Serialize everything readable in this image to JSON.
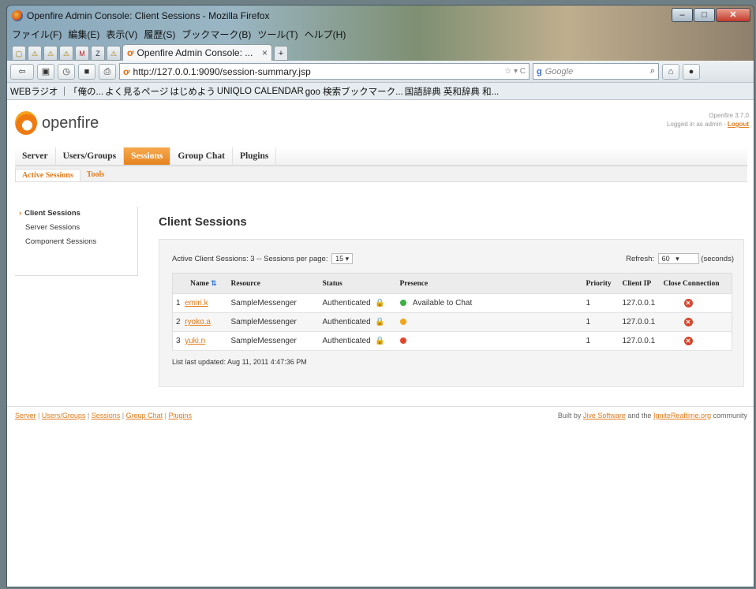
{
  "window": {
    "title": "Openfire Admin Console: Client Sessions - Mozilla Firefox"
  },
  "menu": [
    "ファイル(F)",
    "編集(E)",
    "表示(V)",
    "履歴(S)",
    "ブックマーク(B)",
    "ツール(T)",
    "ヘルプ(H)"
  ],
  "tab": {
    "label": "Openfire Admin Console: ...",
    "close": "×",
    "new": "+"
  },
  "nav": {
    "url": "http://127.0.0.1:9090/session-summary.jsp",
    "search_placeholder": "Google"
  },
  "bookmarks": [
    "WEBラジオ",
    "｜「俺の...",
    "よく見るページ",
    "はじめよう",
    "UNIQLO CALENDAR",
    "goo 検索ブックマーク...",
    "国語辞典 英和辞典 和..."
  ],
  "header": {
    "logo": "openfire",
    "version": "Openfire 3.7.0",
    "logged_in": "Logged in as admin - ",
    "logout": "Logout"
  },
  "main_tabs": [
    "Server",
    "Users/Groups",
    "Sessions",
    "Group Chat",
    "Plugins"
  ],
  "sub_tabs": [
    "Active Sessions",
    "Tools"
  ],
  "sidebar": [
    "Client Sessions",
    "Server Sessions",
    "Component Sessions"
  ],
  "content": {
    "title": "Client Sessions",
    "summary": "Active Client Sessions: 3 -- Sessions per page:",
    "per_page": "15",
    "refresh_label": "Refresh:",
    "refresh_value": "60",
    "refresh_unit": "(seconds)",
    "updated": "List last updated: Aug 11, 2011 4:47:36 PM"
  },
  "table": {
    "headers": [
      "Name",
      "Resource",
      "Status",
      "Presence",
      "Priority",
      "Client IP",
      "Close Connection"
    ],
    "rows": [
      {
        "num": "1",
        "name": "emiri.k",
        "resource": "SampleMessenger",
        "status": "Authenticated",
        "presence": "Available to Chat",
        "presence_color": "#3cb043",
        "priority": "1",
        "ip": "127.0.0.1"
      },
      {
        "num": "2",
        "name": "ryoko.a",
        "resource": "SampleMessenger",
        "status": "Authenticated",
        "presence": "",
        "presence_color": "#f2a516",
        "priority": "1",
        "ip": "127.0.0.1"
      },
      {
        "num": "3",
        "name": "yuki.n",
        "resource": "SampleMessenger",
        "status": "Authenticated",
        "presence": "",
        "presence_color": "#e3452c",
        "priority": "1",
        "ip": "127.0.0.1"
      }
    ]
  },
  "footer": {
    "links": [
      "Server",
      "Users/Groups",
      "Sessions",
      "Group Chat",
      "Plugins"
    ],
    "built_by": "Built by ",
    "jive": "Jive Software",
    "and_the": " and the ",
    "ignite": "IgniteRealtime.org",
    "community": " community"
  }
}
